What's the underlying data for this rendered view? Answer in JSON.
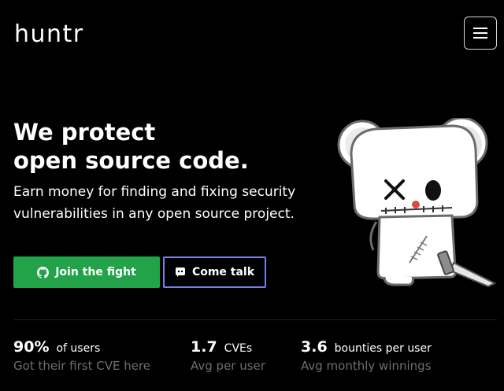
{
  "header": {
    "logo": "huntr",
    "menu_icon": "hamburger-menu-icon"
  },
  "hero": {
    "headline_line1": "We protect",
    "headline_line2": "open source code.",
    "subtitle_line1": "Earn money for finding and fixing security",
    "subtitle_line2": "vulnerabilities in any open source project."
  },
  "buttons": {
    "join_label": "Join the fight",
    "join_icon": "github-icon",
    "talk_label": "Come talk",
    "talk_icon": "discord-icon"
  },
  "stats": [
    {
      "value": "90%",
      "unit": "of users",
      "caption": "Got their first CVE here"
    },
    {
      "value": "1.7",
      "unit": "CVEs",
      "caption": "Avg per user"
    },
    {
      "value": "3.6",
      "unit": "bounties per user",
      "caption": "Avg monthly winnings"
    }
  ],
  "colors": {
    "background": "#000000",
    "primary_button": "#22a34a",
    "secondary_button_border": "#7a7fe6",
    "muted_text": "#6e6e6e"
  }
}
